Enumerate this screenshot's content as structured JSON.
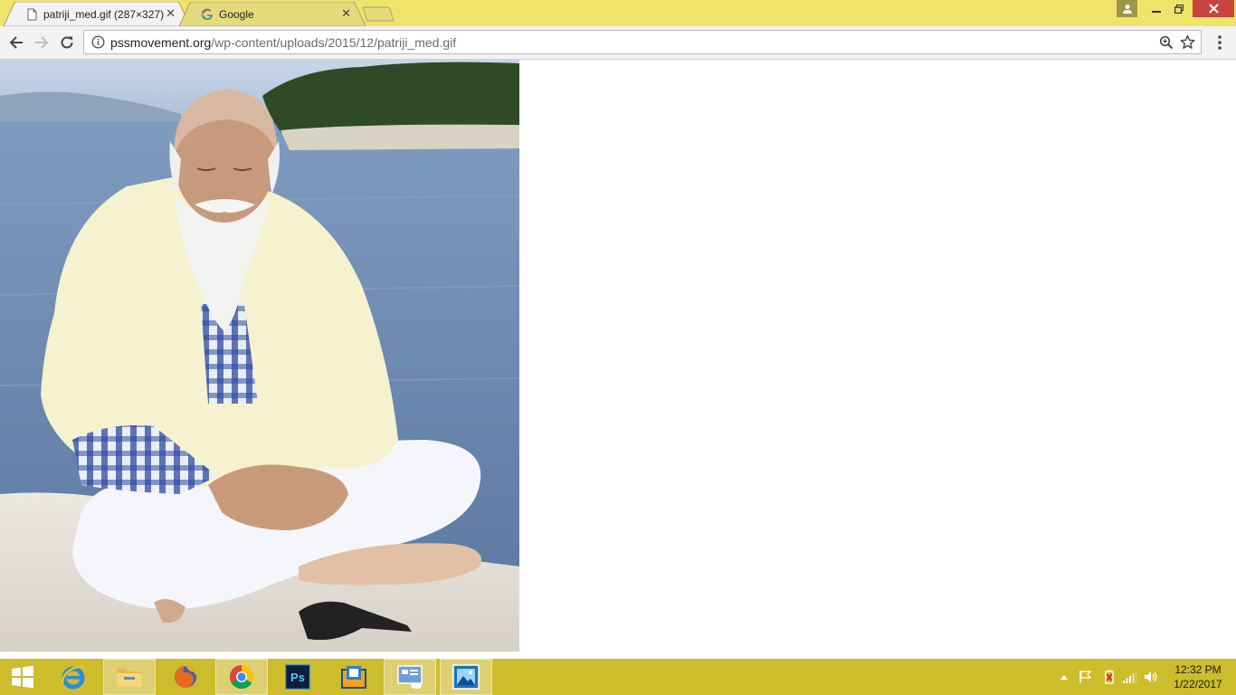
{
  "browser": {
    "tabs": [
      {
        "title": "patriji_med.gif (287×327)",
        "icon": "document-icon",
        "active": true
      },
      {
        "title": "Google",
        "icon": "google-g-icon",
        "active": false
      }
    ],
    "close_glyph": "✕",
    "url": {
      "domain": "pssmovement.org",
      "path": "/wp-content/uploads/2015/12/patriji_med.gif"
    }
  },
  "content": {
    "image_alt": "patriji_med.gif",
    "image_icon": "photo-of-man-meditating-by-sea"
  },
  "taskbar": {
    "apps": [
      {
        "name": "internet-explorer",
        "icon": "ie-icon"
      },
      {
        "name": "file-explorer",
        "icon": "folder-icon"
      },
      {
        "name": "firefox",
        "icon": "firefox-icon"
      },
      {
        "name": "chrome",
        "icon": "chrome-icon"
      },
      {
        "name": "photoshop",
        "icon": "photoshop-icon",
        "label": "Ps"
      },
      {
        "name": "outlook",
        "icon": "outlook-icon"
      },
      {
        "name": "remote-desktop",
        "icon": "remote-desktop-icon"
      },
      {
        "name": "photos",
        "icon": "photos-icon"
      }
    ],
    "clock": {
      "time": "12:32 PM",
      "date": "1/22/2017"
    }
  },
  "colors": {
    "title_bar": "#efe36b",
    "taskbar": "#cdbc2c",
    "close_button": "#c8443d"
  }
}
